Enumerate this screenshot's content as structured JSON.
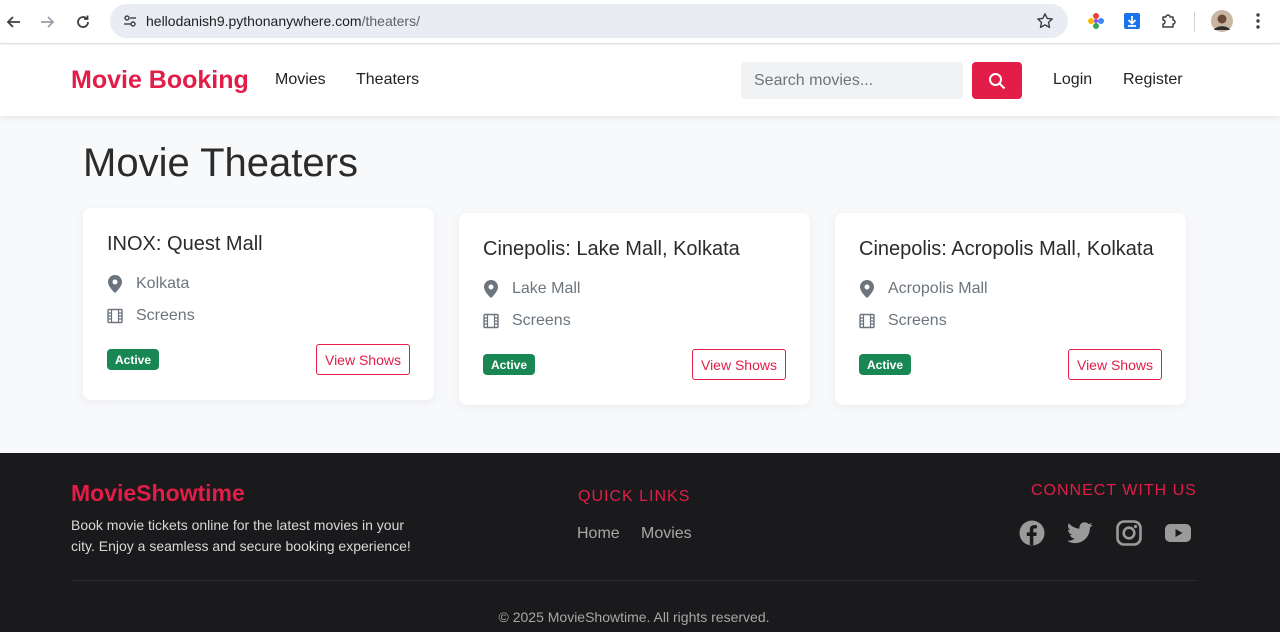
{
  "browser": {
    "url_host": "hellodanish9.pythonanywhere.com",
    "url_path": "/theaters/"
  },
  "navbar": {
    "brand": "Movie Booking",
    "links": [
      "Movies",
      "Theaters"
    ],
    "search_placeholder": "Search movies...",
    "login": "Login",
    "register": "Register"
  },
  "main": {
    "title": "Movie Theaters",
    "theaters": [
      {
        "name": "INOX: Quest Mall",
        "location": "Kolkata",
        "screens_label": "Screens",
        "status": "Active",
        "action": "View Shows"
      },
      {
        "name": "Cinepolis: Lake Mall, Kolkata",
        "location": "Lake Mall",
        "screens_label": "Screens",
        "status": "Active",
        "action": "View Shows"
      },
      {
        "name": "Cinepolis: Acropolis Mall, Kolkata",
        "location": "Acropolis Mall",
        "screens_label": "Screens",
        "status": "Active",
        "action": "View Shows"
      }
    ]
  },
  "footer": {
    "brand": "MovieShowtime",
    "description": "Book movie tickets online for the latest movies in your city. Enjoy a seamless and secure booking experience!",
    "quick_links_heading": "QUICK LINKS",
    "quick_links": [
      "Home",
      "Movies"
    ],
    "connect_heading": "CONNECT WITH US",
    "social_icons": [
      "facebook-icon",
      "twitter-icon",
      "instagram-icon",
      "youtube-icon"
    ],
    "copyright": "© 2025 MovieShowtime. All rights reserved."
  },
  "colors": {
    "accent": "#e11d48",
    "badge_active": "#198754",
    "footer_bg": "#1a1a1c",
    "page_bg": "#f8f9fb"
  }
}
